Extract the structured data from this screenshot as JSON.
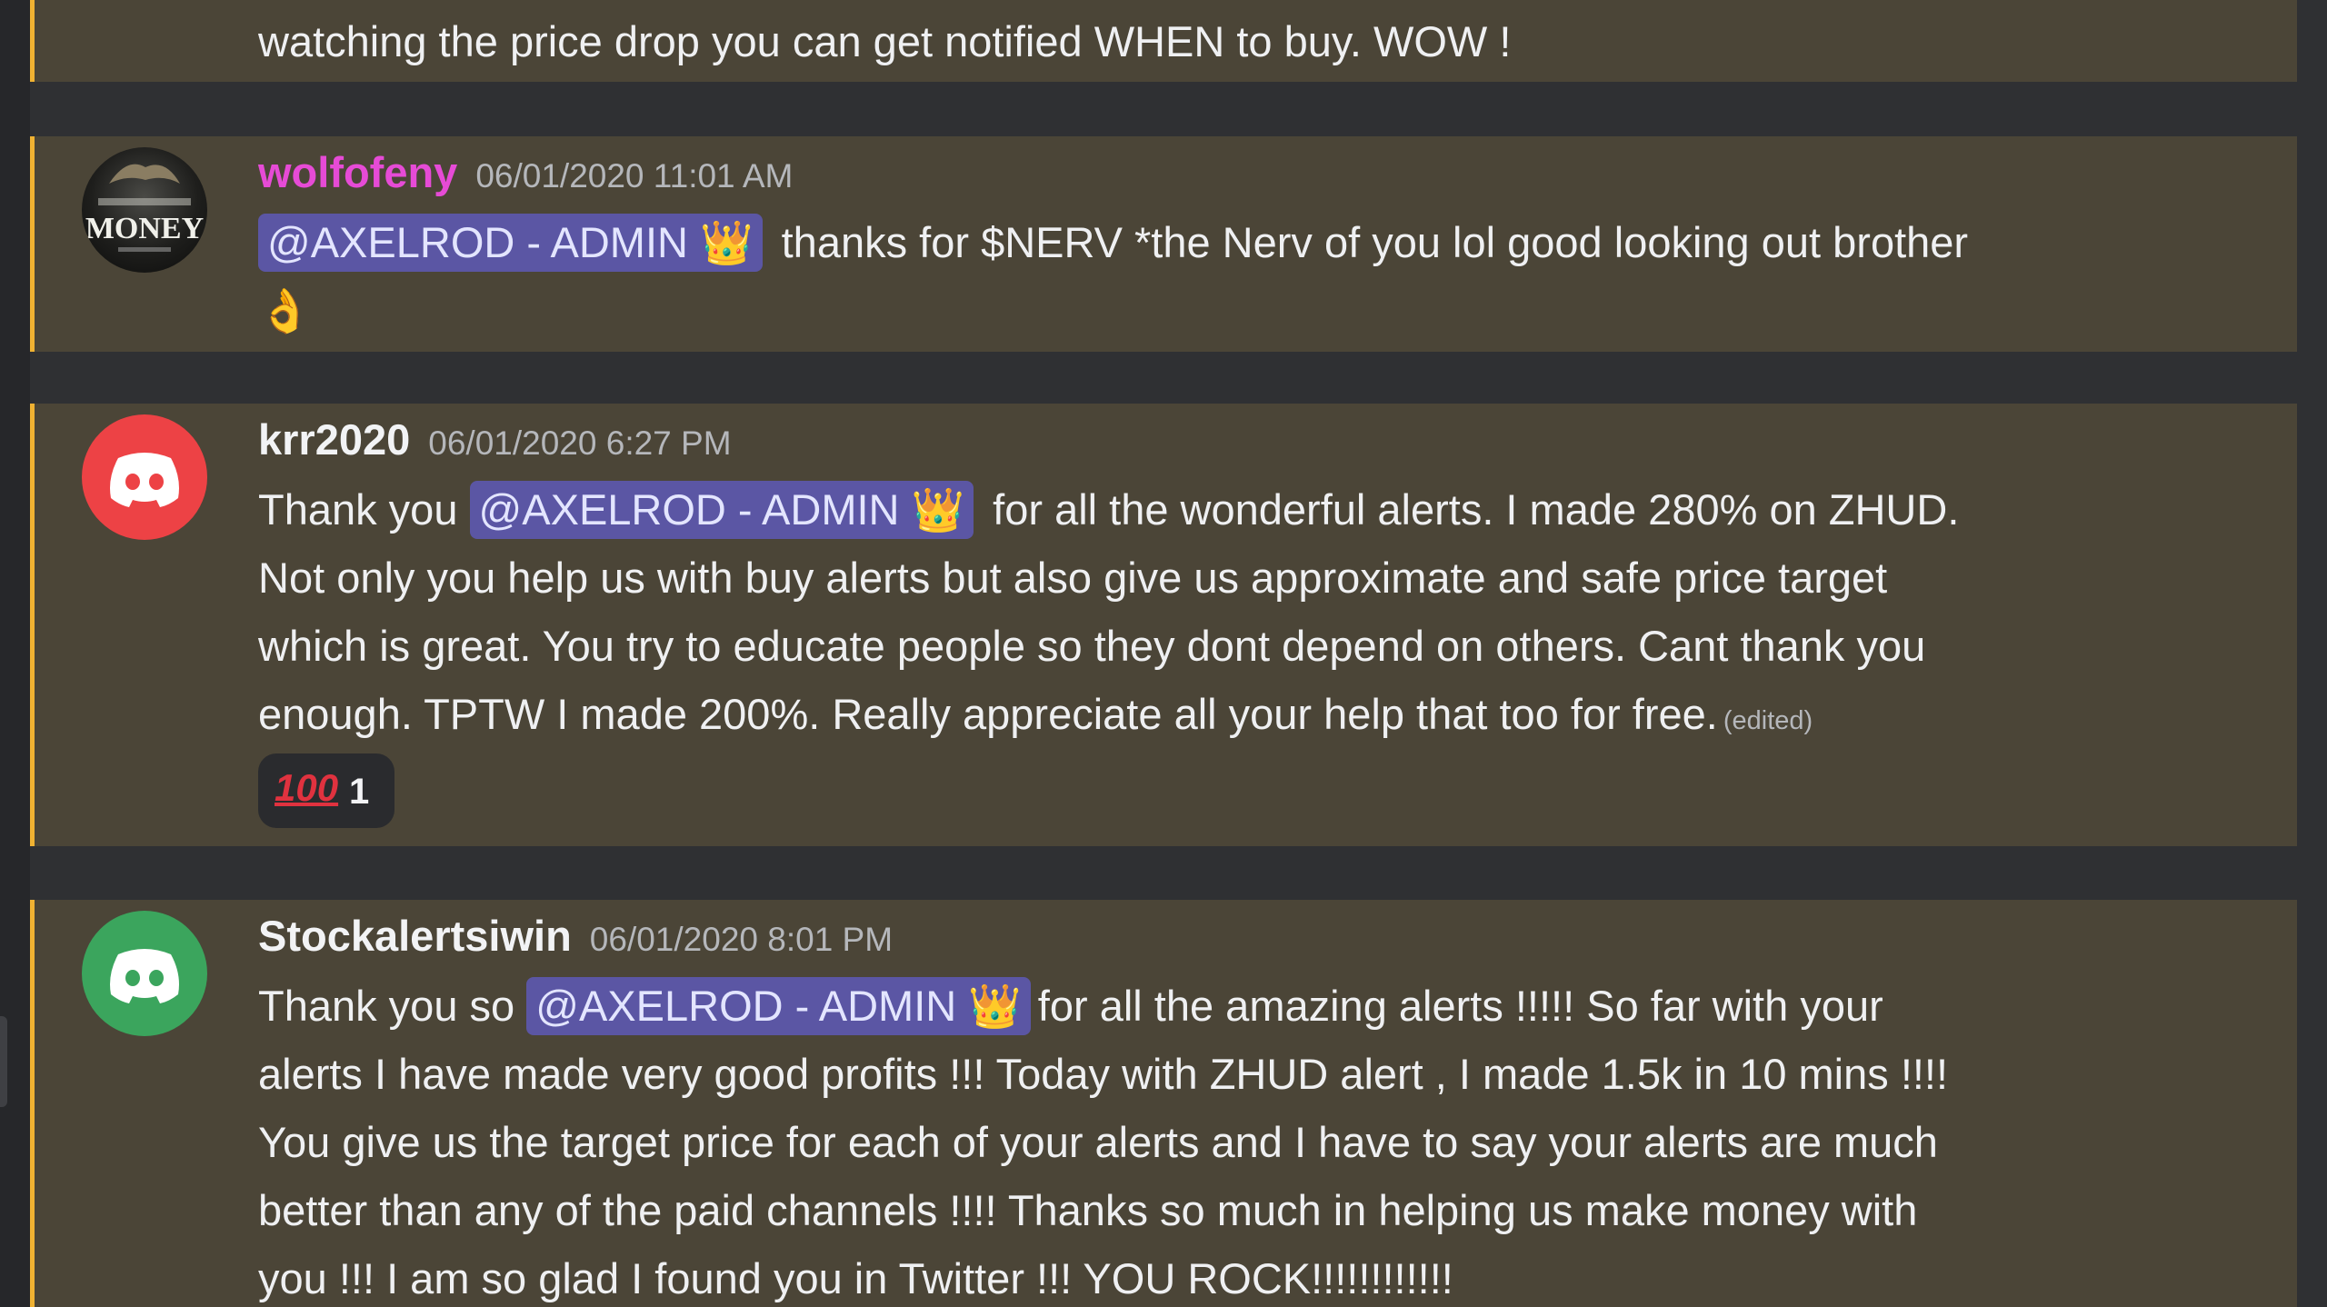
{
  "messages": [
    {
      "lines": [
        "watching the price drop you can get notified WHEN to buy.  WOW !"
      ]
    },
    {
      "username": "wolfofeny",
      "timestamp": "06/01/2020 11:01 AM",
      "avatar_text": "MONEY",
      "mention": "@AXELROD - ADMIN",
      "mention_emoji": "👑",
      "line1_rest": "thanks for $NERV *the Nerv of you lol good looking out brother",
      "line2_emoji": "👌"
    },
    {
      "username": "krr2020",
      "timestamp": "06/01/2020 6:27 PM",
      "prefix": "Thank you",
      "mention": "@AXELROD - ADMIN",
      "mention_emoji": "👑",
      "line1_rest": "for all the wonderful alerts. I made 280% on ZHUD.",
      "lines": [
        "Not only you help us  with buy alerts but also give us approximate and safe price target",
        "which is great. You try to educate people so they dont depend on others. Cant thank you",
        "enough. TPTW I made 200%. Really appreciate all your help that too for free."
      ],
      "edited": "(edited)",
      "reaction": {
        "emoji": "100",
        "count": "1"
      }
    },
    {
      "username": "Stockalertsiwin",
      "timestamp": "06/01/2020 8:01 PM",
      "prefix": "Thank you so",
      "mention": "@AXELROD - ADMIN",
      "mention_emoji": "👑",
      "line1_rest": "for all the amazing alerts !!!!! So far with your",
      "lines": [
        "alerts I have made very good profits !!! Today with ZHUD alert , I made 1.5k in 10 mins !!!!",
        "You give us the target price for each of your alerts and I have to say your alerts are much",
        "better than any of the paid channels !!!! Thanks so much in helping us make money with",
        "you !!! I am so glad I found you in Twitter !!! YOU ROCK!!!!!!!!!!!!"
      ]
    }
  ],
  "colors": {
    "background": "#2f3033",
    "highlight": "#4b4537",
    "highlight_bar": "#f0b232",
    "mention_bg": "#5b56a4",
    "username_pink": "#e64bd6",
    "avatar_red": "#ed4245",
    "avatar_green": "#3ba55d"
  },
  "icons": {
    "avatar_default": "discord-logo-icon",
    "reaction": "hundred-points-icon"
  }
}
